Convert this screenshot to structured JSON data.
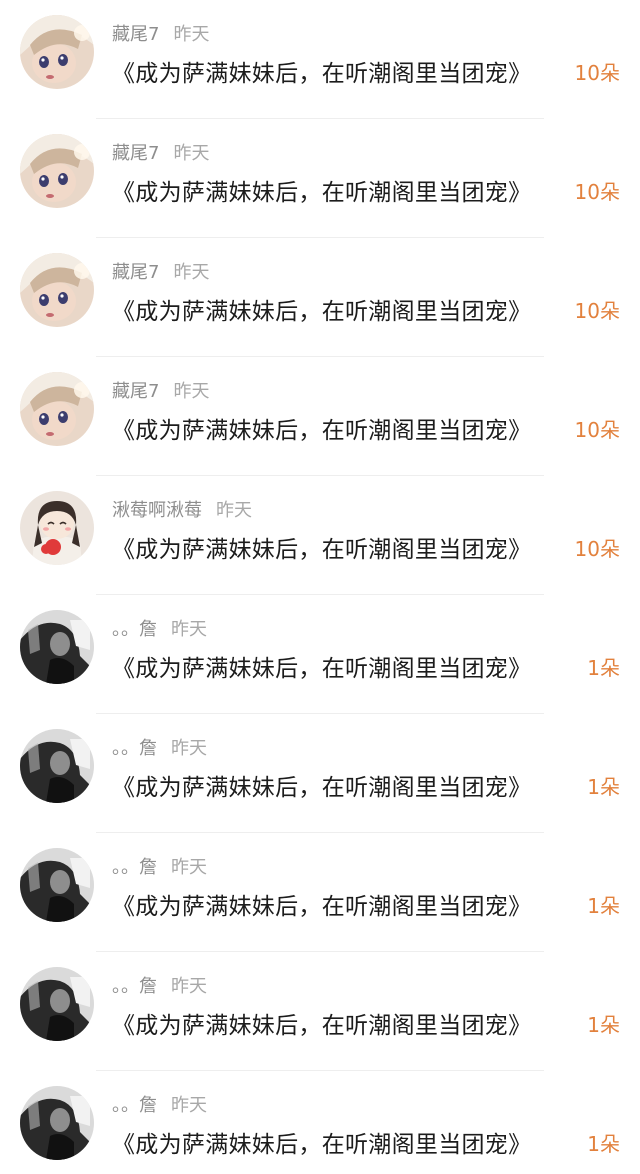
{
  "time_label": "昨天",
  "items": [
    {
      "user": "藏尾7",
      "time": "昨天",
      "title": "《成为萨满妹妹后，在听潮阁里当团宠》",
      "amount": "10朵",
      "avatar": "doll-avatar"
    },
    {
      "user": "藏尾7",
      "time": "昨天",
      "title": "《成为萨满妹妹后，在听潮阁里当团宠》",
      "amount": "10朵",
      "avatar": "doll-avatar"
    },
    {
      "user": "藏尾7",
      "time": "昨天",
      "title": "《成为萨满妹妹后，在听潮阁里当团宠》",
      "amount": "10朵",
      "avatar": "doll-avatar"
    },
    {
      "user": "藏尾7",
      "time": "昨天",
      "title": "《成为萨满妹妹后，在听潮阁里当团宠》",
      "amount": "10朵",
      "avatar": "doll-avatar"
    },
    {
      "user": "湫莓啊湫莓",
      "time": "昨天",
      "title": "《成为萨满妹妹后，在听潮阁里当团宠》",
      "amount": "10朵",
      "avatar": "cartoon-girl-avatar"
    },
    {
      "user": "。。詹",
      "time": "昨天",
      "title": "《成为萨满妹妹后，在听潮阁里当团宠》",
      "amount": "1朵",
      "avatar": "bw-photo-avatar"
    },
    {
      "user": "。。詹",
      "time": "昨天",
      "title": "《成为萨满妹妹后，在听潮阁里当团宠》",
      "amount": "1朵",
      "avatar": "bw-photo-avatar"
    },
    {
      "user": "。。詹",
      "time": "昨天",
      "title": "《成为萨满妹妹后，在听潮阁里当团宠》",
      "amount": "1朵",
      "avatar": "bw-photo-avatar"
    },
    {
      "user": "。。詹",
      "time": "昨天",
      "title": "《成为萨满妹妹后，在听潮阁里当团宠》",
      "amount": "1朵",
      "avatar": "bw-photo-avatar"
    },
    {
      "user": "。。詹",
      "time": "昨天",
      "title": "《成为萨满妹妹后，在听潮阁里当团宠》",
      "amount": "1朵",
      "avatar": "bw-photo-avatar"
    }
  ],
  "colors": {
    "amount": "#e2813d",
    "username": "#8e8e8e",
    "title": "#1c1c1c",
    "divider": "#eeeeee"
  }
}
